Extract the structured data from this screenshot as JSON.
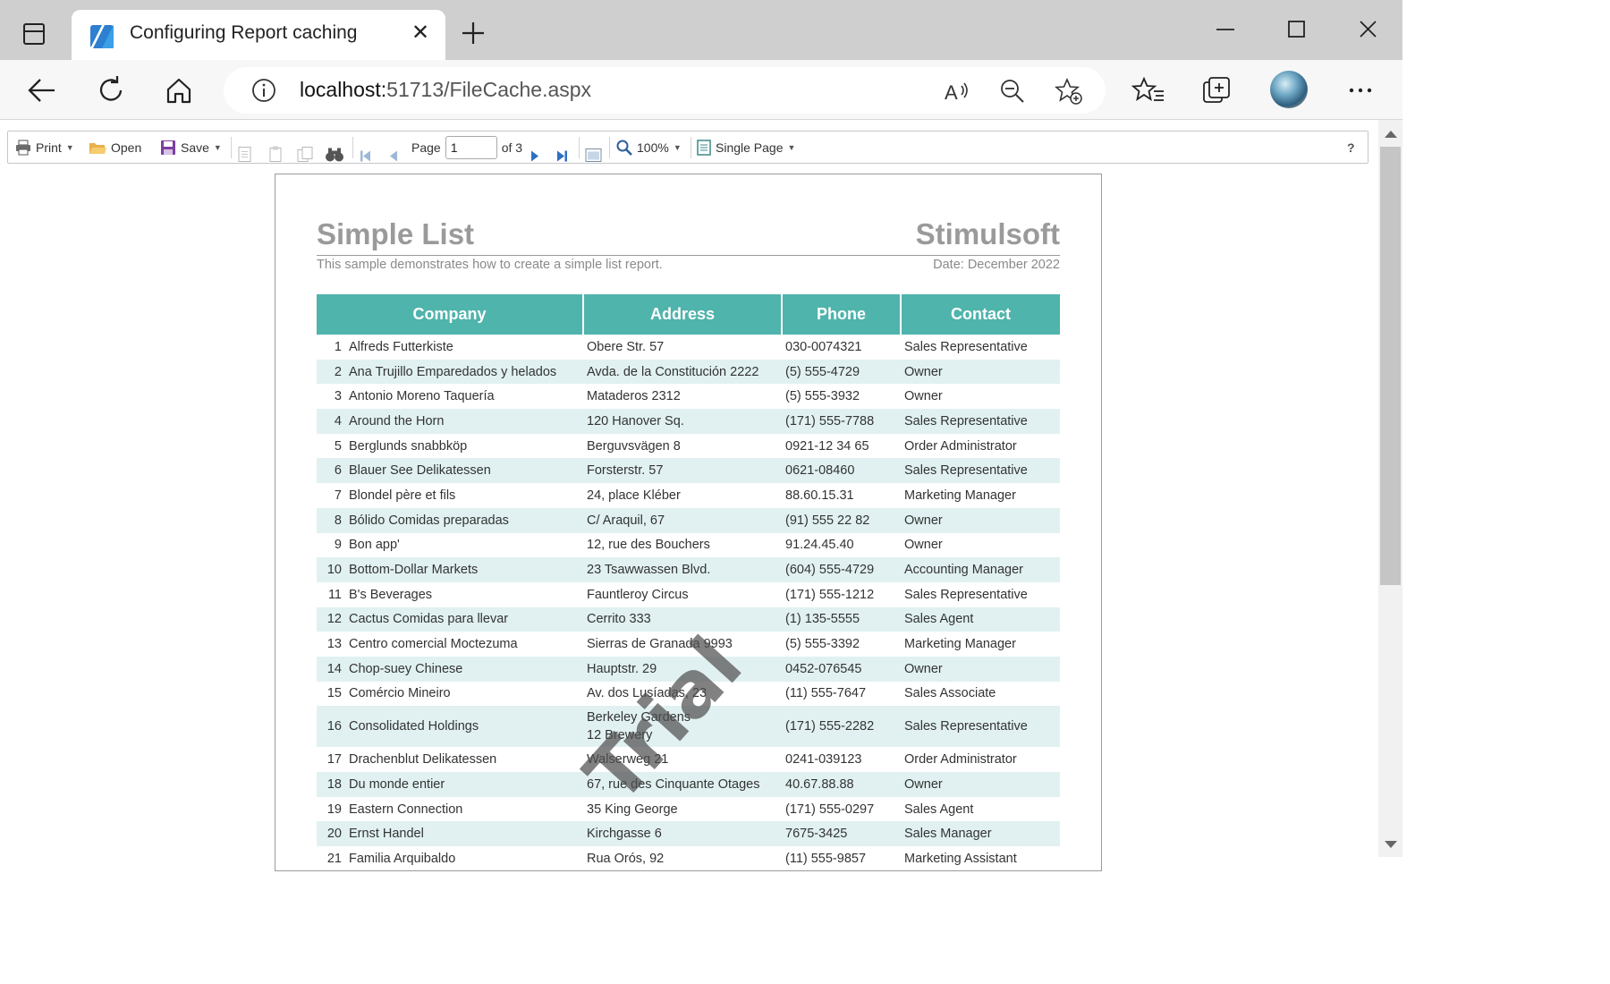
{
  "browser": {
    "tab_title": "Configuring Report caching",
    "url_host": "localhost:",
    "url_path": "51713/FileCache.aspx"
  },
  "toolbar": {
    "print_label": "Print",
    "open_label": "Open",
    "save_label": "Save",
    "page_label": "Page",
    "page_value": "1",
    "page_of": "of 3",
    "zoom_label": "100%",
    "view_mode_label": "Single Page",
    "help_label": "?"
  },
  "report": {
    "title": "Simple List",
    "brand": "Stimulsoft",
    "description": "This sample demonstrates how to create a simple list report.",
    "date": "Date: December 2022",
    "watermark": "Trial",
    "columns": [
      "Company",
      "Address",
      "Phone",
      "Contact"
    ],
    "rows": [
      {
        "n": "1",
        "company": "Alfreds Futterkiste",
        "address": "Obere Str. 57",
        "address2": "",
        "phone": "030-0074321",
        "contact": "Sales Representative"
      },
      {
        "n": "2",
        "company": "Ana Trujillo Emparedados y helados",
        "address": "Avda. de la Constitución 2222",
        "address2": "",
        "phone": "(5) 555-4729",
        "contact": "Owner"
      },
      {
        "n": "3",
        "company": "Antonio Moreno Taquería",
        "address": "Mataderos 2312",
        "address2": "",
        "phone": "(5) 555-3932",
        "contact": "Owner"
      },
      {
        "n": "4",
        "company": "Around the Horn",
        "address": "120 Hanover Sq.",
        "address2": "",
        "phone": "(171) 555-7788",
        "contact": "Sales Representative"
      },
      {
        "n": "5",
        "company": "Berglunds snabbköp",
        "address": "Berguvsvägen 8",
        "address2": "",
        "phone": "0921-12 34 65",
        "contact": "Order Administrator"
      },
      {
        "n": "6",
        "company": "Blauer See Delikatessen",
        "address": "Forsterstr. 57",
        "address2": "",
        "phone": "0621-08460",
        "contact": "Sales Representative"
      },
      {
        "n": "7",
        "company": "Blondel père et fils",
        "address": "24, place Kléber",
        "address2": "",
        "phone": "88.60.15.31",
        "contact": "Marketing Manager"
      },
      {
        "n": "8",
        "company": "Bólido Comidas preparadas",
        "address": "C/ Araquil, 67",
        "address2": "",
        "phone": "(91) 555 22 82",
        "contact": "Owner"
      },
      {
        "n": "9",
        "company": "Bon app'",
        "address": "12, rue des Bouchers",
        "address2": "",
        "phone": "91.24.45.40",
        "contact": "Owner"
      },
      {
        "n": "10",
        "company": "Bottom-Dollar Markets",
        "address": "23 Tsawwassen Blvd.",
        "address2": "",
        "phone": "(604) 555-4729",
        "contact": "Accounting Manager"
      },
      {
        "n": "11",
        "company": "B's Beverages",
        "address": "Fauntleroy Circus",
        "address2": "",
        "phone": "(171) 555-1212",
        "contact": "Sales Representative"
      },
      {
        "n": "12",
        "company": "Cactus Comidas para llevar",
        "address": "Cerrito 333",
        "address2": "",
        "phone": "(1) 135-5555",
        "contact": "Sales Agent"
      },
      {
        "n": "13",
        "company": "Centro comercial Moctezuma",
        "address": "Sierras de Granada 9993",
        "address2": "",
        "phone": "(5) 555-3392",
        "contact": "Marketing Manager"
      },
      {
        "n": "14",
        "company": "Chop-suey Chinese",
        "address": "Hauptstr. 29",
        "address2": "",
        "phone": "0452-076545",
        "contact": "Owner"
      },
      {
        "n": "15",
        "company": "Comércio Mineiro",
        "address": "Av. dos Lusíadas, 23",
        "address2": "",
        "phone": "(11) 555-7647",
        "contact": "Sales Associate"
      },
      {
        "n": "16",
        "company": "Consolidated Holdings",
        "address": "Berkeley Gardens",
        "address2": "12 Brewery",
        "phone": "(171) 555-2282",
        "contact": "Sales Representative"
      },
      {
        "n": "17",
        "company": "Drachenblut Delikatessen",
        "address": "Walserweg 21",
        "address2": "",
        "phone": "0241-039123",
        "contact": "Order Administrator"
      },
      {
        "n": "18",
        "company": "Du monde entier",
        "address": "67, rue des Cinquante Otages",
        "address2": "",
        "phone": "40.67.88.88",
        "contact": "Owner"
      },
      {
        "n": "19",
        "company": "Eastern Connection",
        "address": "35 King George",
        "address2": "",
        "phone": "(171) 555-0297",
        "contact": "Sales Agent"
      },
      {
        "n": "20",
        "company": "Ernst Handel",
        "address": "Kirchgasse 6",
        "address2": "",
        "phone": "7675-3425",
        "contact": "Sales Manager"
      },
      {
        "n": "21",
        "company": "Familia Arquibaldo",
        "address": "Rua Orós, 92",
        "address2": "",
        "phone": "(11) 555-9857",
        "contact": "Marketing Assistant"
      }
    ]
  }
}
